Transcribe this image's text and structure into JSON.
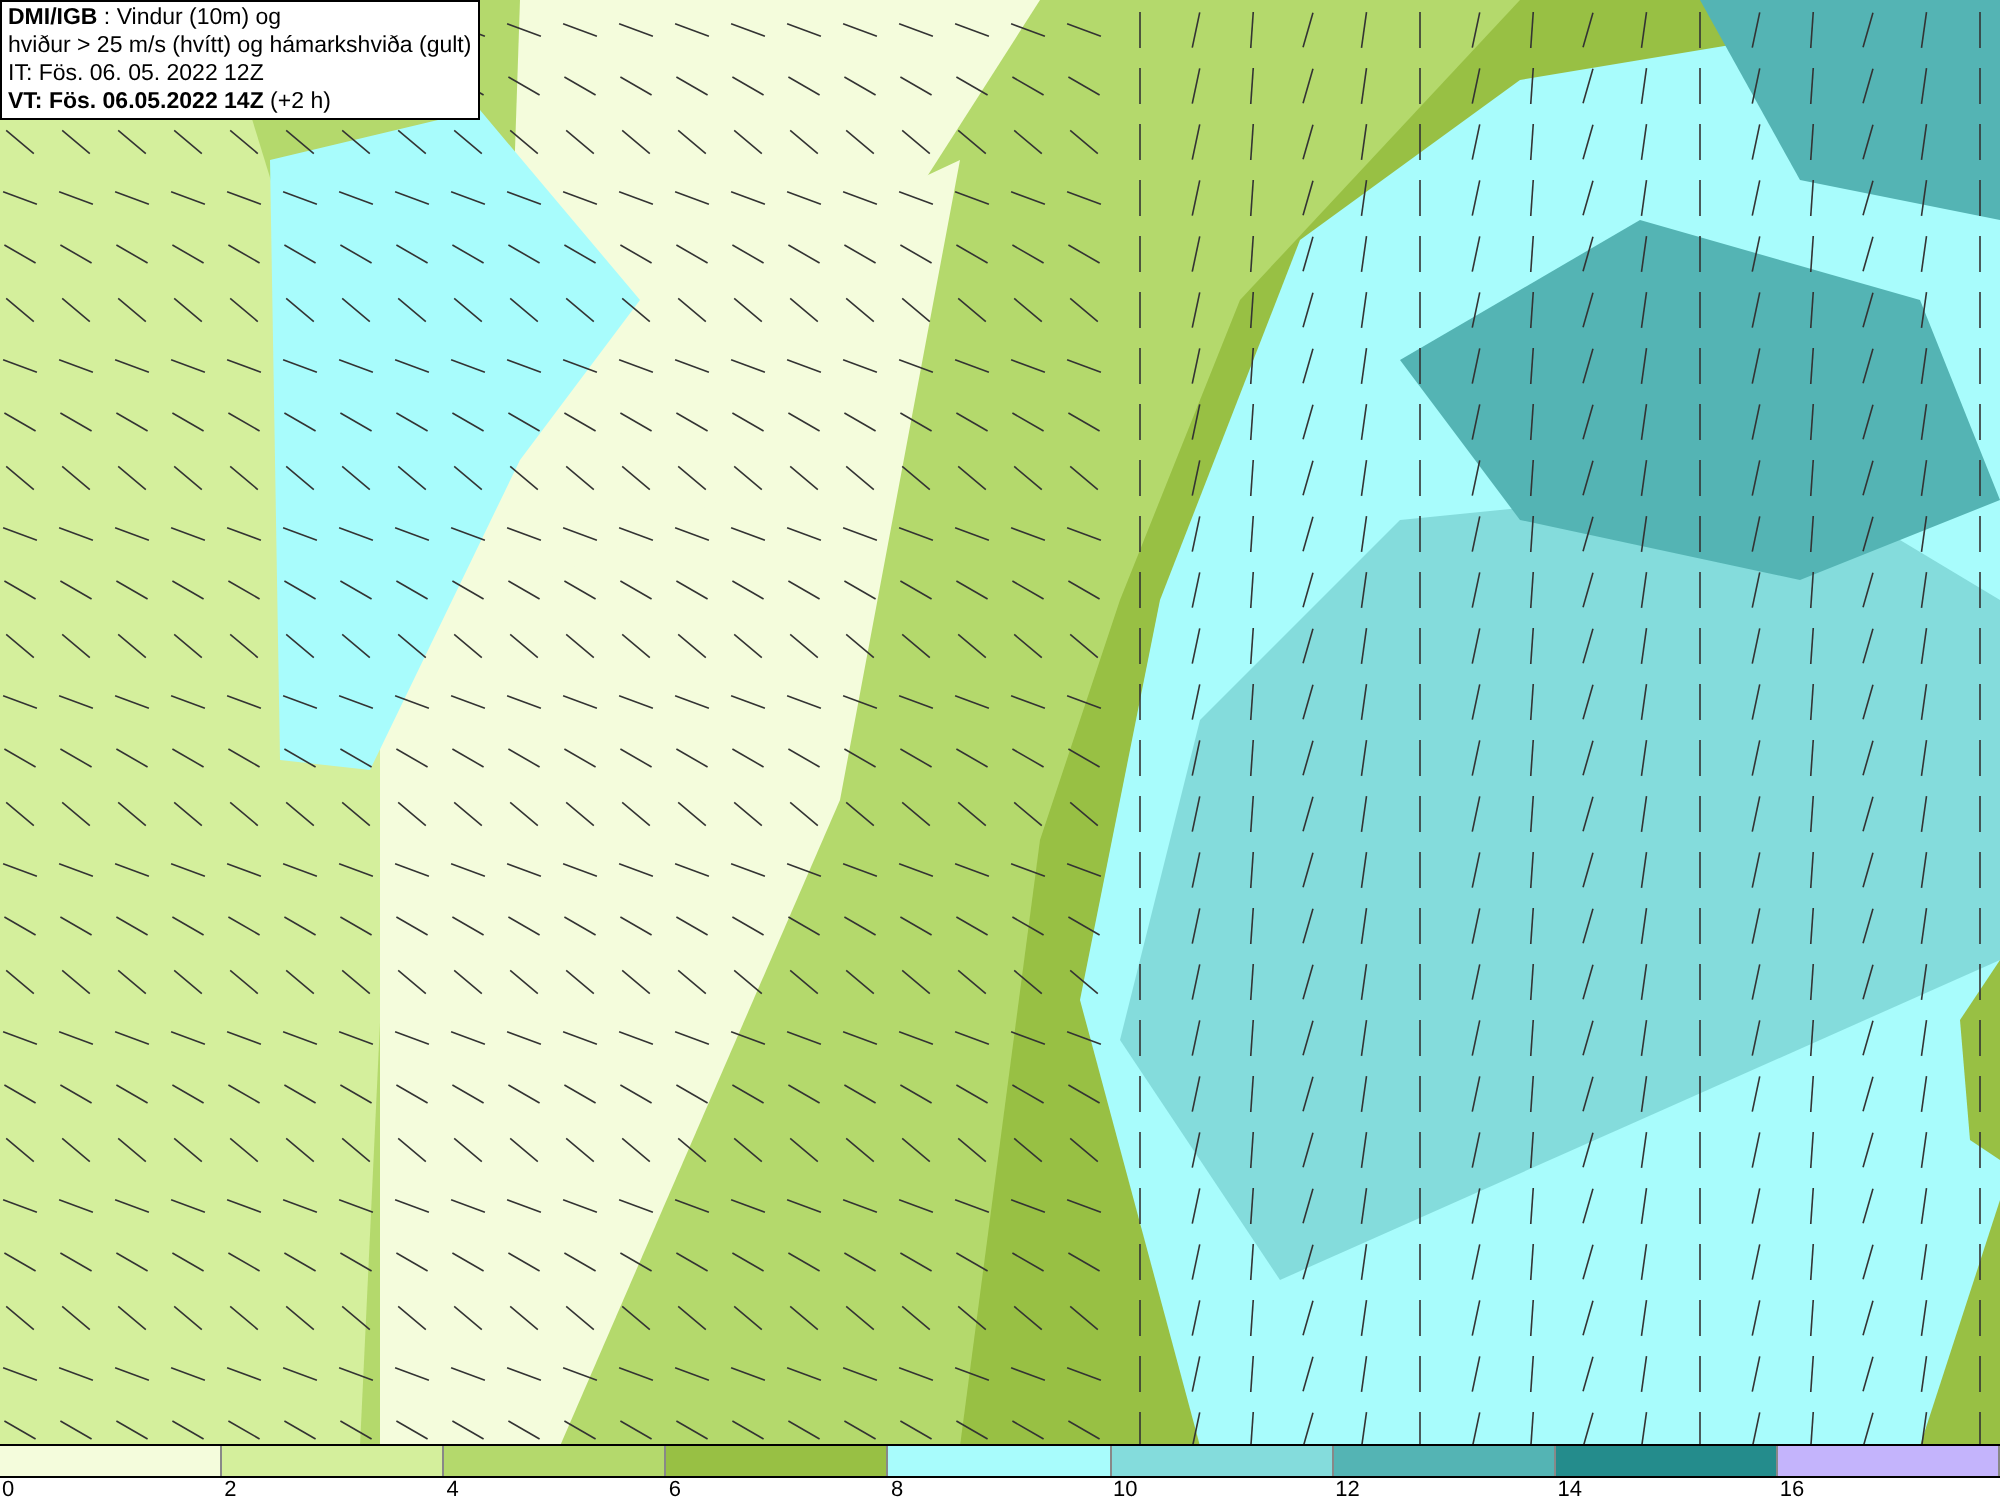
{
  "info_box": {
    "lines": [
      "**DMI/IGB** : Vindur (10m) og",
      "hviður > 25 m/s (hvítt) og hámarkshviða (gult)",
      "IT: Fös. 06. 05. 2022 12Z",
      "**VT: Fös. 06.05.2022 14Z** (+2 h)"
    ]
  },
  "legend": {
    "segments": [
      {
        "color": "#f4fcdc"
      },
      {
        "color": "#d4ef9c"
      },
      {
        "color": "#b4d96c"
      },
      {
        "color": "#98c044"
      },
      {
        "color": "#a8fcfc"
      },
      {
        "color": "#84dcdc"
      },
      {
        "color": "#54b4b4"
      },
      {
        "color": "#248c8c"
      },
      {
        "color": "#c4b4fc"
      }
    ],
    "ticks": [
      "0",
      "2",
      "4",
      "6",
      "8",
      "10",
      "12",
      "14",
      "16"
    ]
  }
}
